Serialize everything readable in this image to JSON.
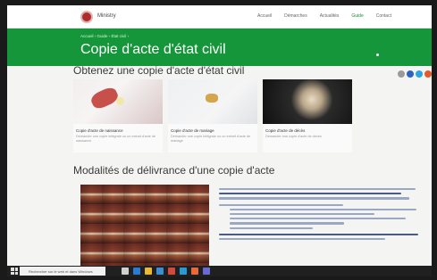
{
  "header": {
    "site_name": "Ministry",
    "nav": [
      "Accueil",
      "Démarches",
      "Actualités",
      "Guide",
      "Contact"
    ]
  },
  "banner": {
    "breadcrumb": "Accueil  ›  Guide  ›  État civil  ›",
    "title": "Copie d'acte d'état civil"
  },
  "section1": {
    "title": "Obtenez une copie d'acte d'état civil",
    "cards": [
      {
        "title": "Copie d'acte de naissance",
        "desc": "Demander une copie intégrale ou un extrait d'acte de naissance"
      },
      {
        "title": "Copie d'acte de mariage",
        "desc": "Demander une copie intégrale ou un extrait d'acte de mariage"
      },
      {
        "title": "Copie d'acte de décès",
        "desc": "Demander une copie d'acte de décès"
      }
    ]
  },
  "section2": {
    "title": "Modalités de délivrance d'une copie d'acte"
  },
  "share_colors": [
    "#9a9a9a",
    "#2a63c4",
    "#2aa6e4",
    "#e45a2a"
  ],
  "taskbar": {
    "search_placeholder": "Rechercher sur le web et dans Windows"
  }
}
